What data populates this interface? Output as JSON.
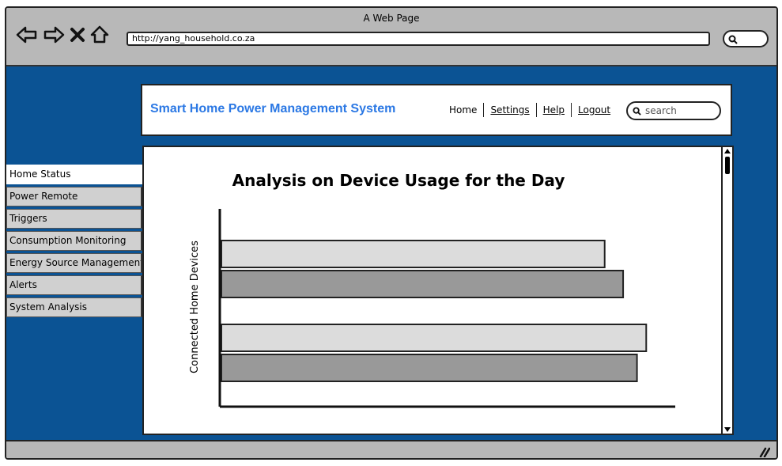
{
  "browser": {
    "title": "A Web Page",
    "url": "http://yang_household.co.za",
    "icons": [
      "back-arrow-icon",
      "forward-arrow-icon",
      "close-x-icon",
      "home-icon",
      "search-icon"
    ]
  },
  "header": {
    "brand": "Smart Home Power Management System",
    "nav": [
      "Home",
      "Settings",
      "Help",
      "Logout"
    ],
    "search_placeholder": "search"
  },
  "sidebar": {
    "items": [
      {
        "label": "Home Status",
        "active": true
      },
      {
        "label": "Power Remote",
        "active": false
      },
      {
        "label": "Triggers",
        "active": false
      },
      {
        "label": "Consumption Monitoring",
        "active": false
      },
      {
        "label": "Energy Source Management",
        "active": false
      },
      {
        "label": "Alerts",
        "active": false
      },
      {
        "label": "System Analysis",
        "active": false
      }
    ]
  },
  "colors": {
    "brand": "#2b78e4",
    "background": "#0b5394",
    "chrome": "#b8b8b8",
    "bar_light": "#dcdcdc",
    "bar_dark": "#999999"
  },
  "chart_data": {
    "type": "bar",
    "orientation": "horizontal",
    "title": "Analysis on Device Usage for the Day",
    "xlabel": "",
    "ylabel": "Connected Home Devices",
    "xlim": [
      0,
      100
    ],
    "grid": false,
    "series": [
      {
        "color": "#dcdcdc",
        "values": [
          83,
          92
        ]
      },
      {
        "color": "#999999",
        "values": [
          87,
          90
        ]
      }
    ],
    "categories": [
      "",
      ""
    ]
  }
}
